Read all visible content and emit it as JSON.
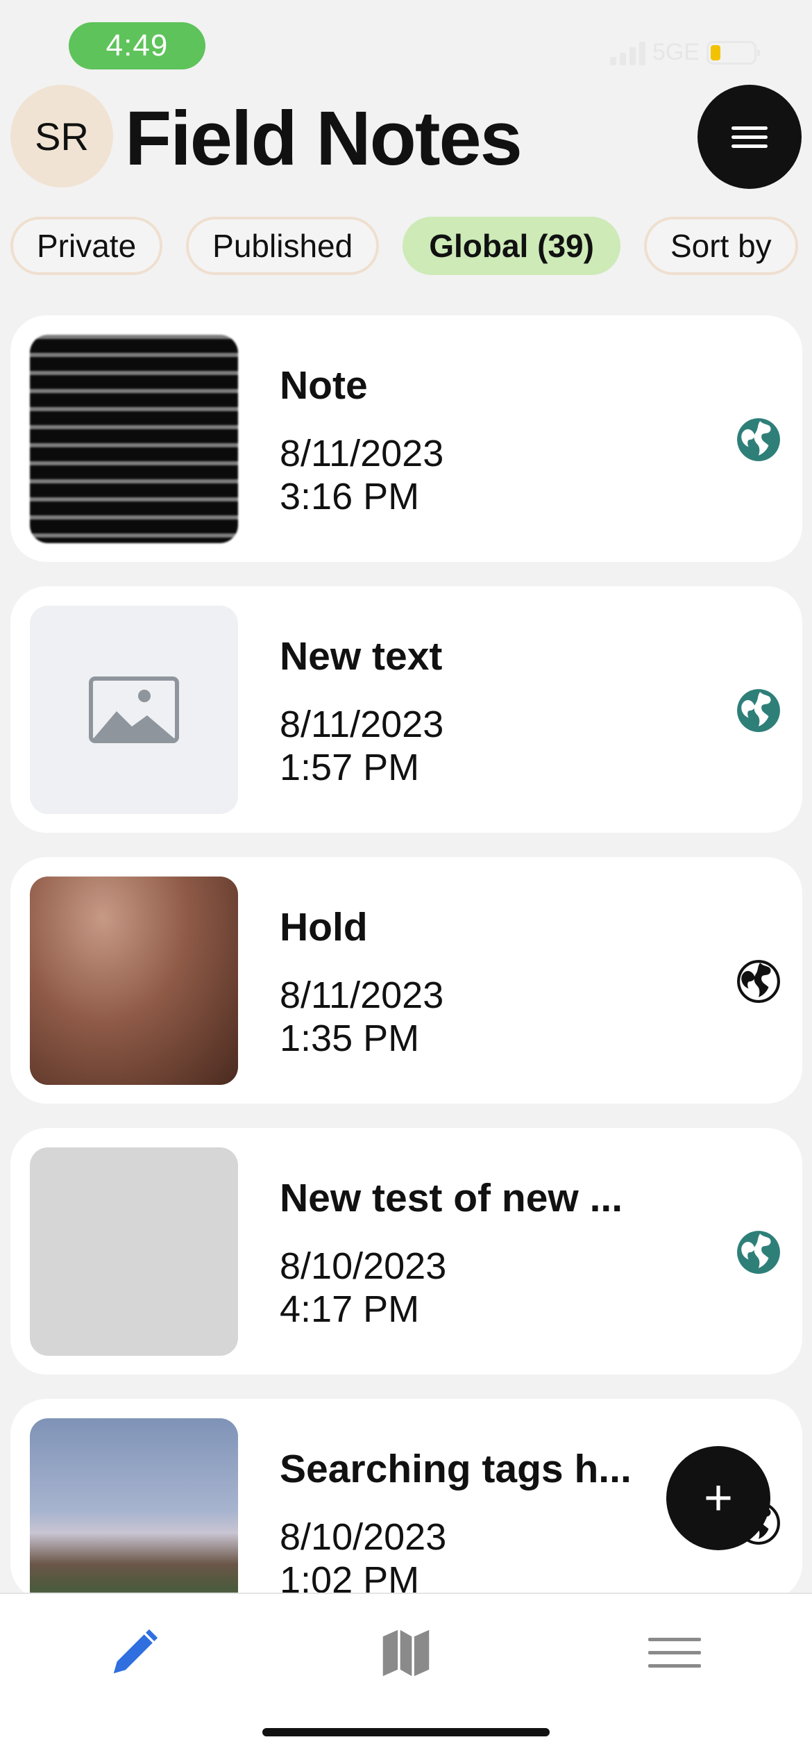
{
  "status_bar": {
    "time": "4:49",
    "network": "5GE",
    "battery_level": 0.15
  },
  "header": {
    "avatar_initials": "SR",
    "title": "Field Notes",
    "menu_icon": "hamburger-icon"
  },
  "filters": [
    {
      "label": "Private",
      "active": false
    },
    {
      "label": "Published",
      "active": false
    },
    {
      "label": "Global (39)",
      "active": true
    },
    {
      "label": "Sort by",
      "active": false
    }
  ],
  "notes": [
    {
      "title": "Note",
      "date": "8/11/2023",
      "time": "3:16 PM",
      "thumbnail": "terminal-screenshot",
      "globe_color": "#2f7f79"
    },
    {
      "title": "New text",
      "date": "8/11/2023",
      "time": "1:57 PM",
      "thumbnail": "image-placeholder",
      "globe_color": "#2f7f79"
    },
    {
      "title": "Hold",
      "date": "8/11/2023",
      "time": "1:35 PM",
      "thumbnail": "blurred-photo",
      "globe_color": "#111111"
    },
    {
      "title": "New test of new ...",
      "date": "8/10/2023",
      "time": "4:17 PM",
      "thumbnail": "gray-blank",
      "globe_color": "#2f7f79"
    },
    {
      "title": "Searching tags h...",
      "date": "8/10/2023",
      "time": "1:02 PM",
      "thumbnail": "city-photo",
      "globe_color": "#111111"
    }
  ],
  "fab": {
    "label": "+",
    "icon": "plus-icon"
  },
  "tabbar": {
    "items": [
      {
        "icon": "pencil-icon",
        "active": true,
        "color": "#2f6fe0"
      },
      {
        "icon": "map-icon",
        "active": false,
        "color": "#8a8a8a"
      },
      {
        "icon": "list-icon",
        "active": false,
        "color": "#8a8a8a"
      }
    ]
  }
}
